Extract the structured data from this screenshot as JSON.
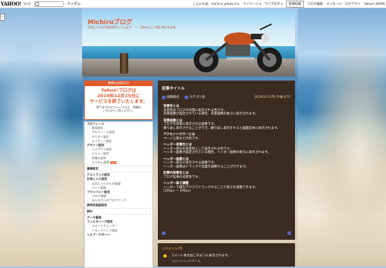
{
  "topbar": {
    "logo": "YAHOO!",
    "logo_sub": "ブログ",
    "search_placeholder": "",
    "random_label": "ランダム",
    "greeting": "こんにちは、michiru_photoさん",
    "my_page": "マイページ ▾",
    "my_blog": "マイブログ ▾",
    "new_post": "新規投稿",
    "blog_search": "ブログ検索",
    "message": "メッセージ",
    "logout": "ログアウト",
    "yahoo_japan": "Yahoo! JAPAN"
  },
  "header": {
    "title": "Michiruブログ",
    "description": "お気に入りの写真を紹介しています　―　日本のどこか遠い所での日常"
  },
  "notice": {
    "head": "重要なお知らせ",
    "main_line1": "Yahoo!ブログは",
    "main_line2": "2019年12月15日に",
    "main_line3": "サービスを終了いたします。",
    "sub_line1": "終了までのスケジュールなど、詳細は",
    "sub_line2": "こちらからご覧ください。"
  },
  "menu": {
    "profile": "プロフィール",
    "profile_items": [
      "基本設定",
      "プロフィール設定",
      "アバター設定",
      "メッセージ設定"
    ],
    "design": "デザイン設定",
    "design_items": [
      "レイアウト設定",
      "メニュー設定",
      "背景の変更",
      "カスタム背景"
    ],
    "new_tag": "NEW",
    "manage": "書庫設定",
    "guestbook": "ゲストブック設定",
    "favorite": "お気に入り設定",
    "favorite_items": [
      "お気に入りの人の管理",
      "ファン管理"
    ],
    "privacy": "プライバシー設定",
    "privacy_items": [
      "ブログ管理",
      "みんなからのブログリンク"
    ],
    "trackback": "携帯用画面設定",
    "stats": "統計",
    "data": "データ管理",
    "filter": "フィルタリング設定",
    "filter_items": [
      "コメントチェッカー",
      "トラックバック設定"
    ],
    "help": "ヘルプ・サポート"
  },
  "article": {
    "title": "記事タイトル",
    "author": "投稿者名",
    "category": "カテゴリ名",
    "date": "2019/3/11(月) 午後 6:57",
    "sections": [
      {
        "head": "背景色とは",
        "lines": [
          "背景色はブログの背景に表示される色です。",
          "背景画像が設定されている場合、背景画像の後ろに表示されます。"
        ]
      },
      {
        "head": "背景画像とは",
        "lines": [
          "ブログの背景に表示される画像です。",
          "繰り返し表示させることができ、繰り返し表示をすると画面全体に表示されます。"
        ]
      },
      {
        "head": "アクセントカラーとは",
        "lines": [
          "ページ上部などの色です。"
        ]
      },
      {
        "head": "ヘッダー背景色とは",
        "lines": [
          "ヘッダー部分の背景色として表示される色です。",
          "ヘッダー画像が設定されている場合、ヘッダー画像の後ろに表示されます。"
        ]
      },
      {
        "head": "ヘッダー画像とは",
        "lines": [
          "ヘッダー部分に表示される画像です。",
          "ヘッダー画像はドラッグで位置を調整することができます。"
        ]
      },
      {
        "head": "記事内背景色とは",
        "lines": [
          "ブログ記事の背景色です。"
        ]
      },
      {
        "head": "ヘッダー高さ調整",
        "lines": [
          "ヘッダー下部をマウスでドラッグすることで高さを調整できます。",
          "(100px 〜 290px)"
        ]
      }
    ]
  },
  "comments": {
    "head": "◇コメント(3)",
    "comment1": "コメント本文はこのように表示されます。",
    "comment2": "コメントニックネーム"
  },
  "colors": {
    "accent": "#e05a2a",
    "article_bg": "#3b2b20",
    "title_color": "#e45a2b"
  }
}
